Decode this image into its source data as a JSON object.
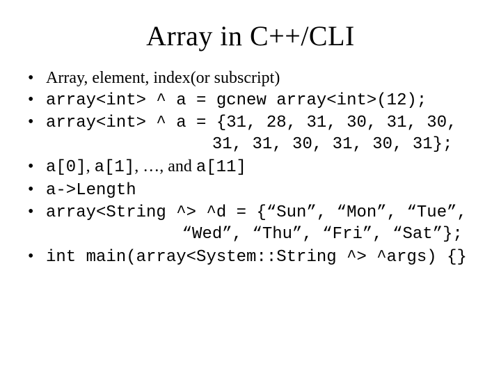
{
  "title": "Array in C++/CLI",
  "bullets": [
    {
      "text": "Array, element, index(or subscript)",
      "font": "serif"
    },
    {
      "text": "array<int> ^ a = gcnew array<int>(12);",
      "font": "mono"
    },
    {
      "text": "array<int> ^ a = {31, 28, 31, 30, 31, 30,",
      "font": "mono",
      "continuation": "                 31, 31, 30, 31, 30, 31};"
    },
    {
      "text_parts": [
        {
          "t": "a[0]",
          "font": "mono"
        },
        {
          "t": ", ",
          "font": "serif"
        },
        {
          "t": "a[1]",
          "font": "mono"
        },
        {
          "t": ", …, ",
          "font": "serif"
        },
        {
          "t": "and ",
          "font": "serif"
        },
        {
          "t": "a[11]",
          "font": "mono"
        }
      ]
    },
    {
      "text": "a->Length",
      "font": "mono"
    },
    {
      "text": "array<String ^> ^d = {“Sun”, “Mon”, “Tue”,",
      "font": "mono",
      "continuation": "              “Wed”, “Thu”, “Fri”, “Sat”};"
    },
    {
      "text": "int main(array<System::String ^> ^args) {}",
      "font": "mono"
    }
  ]
}
